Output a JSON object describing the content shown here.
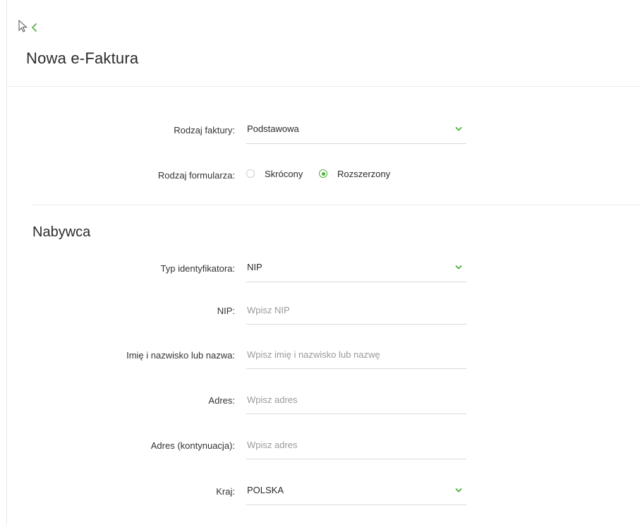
{
  "header": {
    "title": "Nowa e-Faktura"
  },
  "form": {
    "invoice_type": {
      "label": "Rodzaj faktury:",
      "value": "Podstawowa"
    },
    "form_type": {
      "label": "Rodzaj formularza:",
      "options": [
        {
          "label": "Skrócony",
          "selected": false
        },
        {
          "label": "Rozszerzony",
          "selected": true
        }
      ]
    }
  },
  "buyer": {
    "section_title": "Nabywca",
    "identifier_type": {
      "label": "Typ identyfikatora:",
      "value": "NIP"
    },
    "nip": {
      "label": "NIP:",
      "placeholder": "Wpisz NIP"
    },
    "name": {
      "label": "Imię i nazwisko lub nazwa:",
      "placeholder": "Wpisz imię i nazwisko lub nazwę"
    },
    "address": {
      "label": "Adres:",
      "placeholder": "Wpisz adres"
    },
    "address2": {
      "label": "Adres (kontynuacja):",
      "placeholder": "Wpisz adres"
    },
    "country": {
      "label": "Kraj:",
      "value": "POLSKA"
    }
  },
  "colors": {
    "accent": "#4caf3a",
    "divider": "#ebebeb",
    "placeholder": "#9a9a9a"
  },
  "icons": {
    "back": "chevron-left-icon",
    "dropdown": "chevron-down-icon",
    "cursor": "mouse-pointer-icon"
  }
}
